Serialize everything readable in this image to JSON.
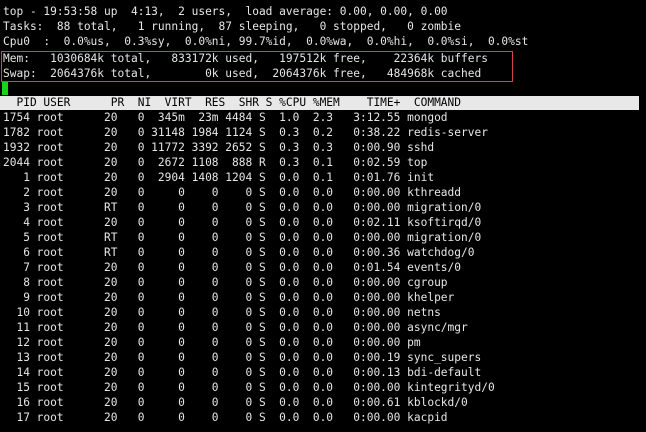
{
  "summary": {
    "line1": "top - 19:53:58 up  4:13,  2 users,  load average: 0.00, 0.00, 0.00",
    "tasks": "Tasks:  88 total,   1 running,  87 sleeping,   0 stopped,   0 zombie",
    "cpu": "Cpu0  :  0.0%us,  0.3%sy,  0.0%ni, 99.7%id,  0.0%wa,  0.0%hi,  0.0%si,  0.0%st",
    "mem": "Mem:   1030684k total,   833172k used,   197512k free,    22364k buffers",
    "swap": "Swap:  2064376k total,        0k used,  2064376k free,   484968k cached"
  },
  "header": "  PID USER      PR  NI  VIRT  RES  SHR S %CPU %MEM    TIME+  COMMAND",
  "processes": [
    "1754 root      20   0  345m  23m 4484 S  1.0  2.3   3:12.55 mongod",
    "1782 root      20   0 31148 1984 1124 S  0.3  0.2   0:38.22 redis-server",
    "1932 root      20   0 11772 3392 2652 S  0.3  0.3   0:00.90 sshd",
    "2044 root      20   0  2672 1108  888 R  0.3  0.1   0:02.59 top",
    "   1 root      20   0  2904 1408 1204 S  0.0  0.1   0:01.76 init",
    "   2 root      20   0     0    0    0 S  0.0  0.0   0:00.00 kthreadd",
    "   3 root      RT   0     0    0    0 S  0.0  0.0   0:00.00 migration/0",
    "   4 root      20   0     0    0    0 S  0.0  0.0   0:02.11 ksoftirqd/0",
    "   5 root      RT   0     0    0    0 S  0.0  0.0   0:00.00 migration/0",
    "   6 root      RT   0     0    0    0 S  0.0  0.0   0:00.36 watchdog/0",
    "   7 root      20   0     0    0    0 S  0.0  0.0   0:01.54 events/0",
    "   8 root      20   0     0    0    0 S  0.0  0.0   0:00.00 cgroup",
    "   9 root      20   0     0    0    0 S  0.0  0.0   0:00.00 khelper",
    "  10 root      20   0     0    0    0 S  0.0  0.0   0:00.00 netns",
    "  11 root      20   0     0    0    0 S  0.0  0.0   0:00.00 async/mgr",
    "  12 root      20   0     0    0    0 S  0.0  0.0   0:00.00 pm",
    "  13 root      20   0     0    0    0 S  0.0  0.0   0:00.19 sync_supers",
    "  14 root      20   0     0    0    0 S  0.0  0.0   0:00.13 bdi-default",
    "  15 root      20   0     0    0    0 S  0.0  0.0   0:00.00 kintegrityd/0",
    "  16 root      20   0     0    0    0 S  0.0  0.0   0:00.61 kblockd/0",
    "  17 root      20   0     0    0    0 S  0.0  0.0   0:00.00 kacpid"
  ],
  "colors": {
    "background": "#000000",
    "text": "#e6e6e6",
    "header_bar": "#e8e8e8",
    "highlight_box": "#d0454a",
    "cursor": "#19d21b"
  }
}
